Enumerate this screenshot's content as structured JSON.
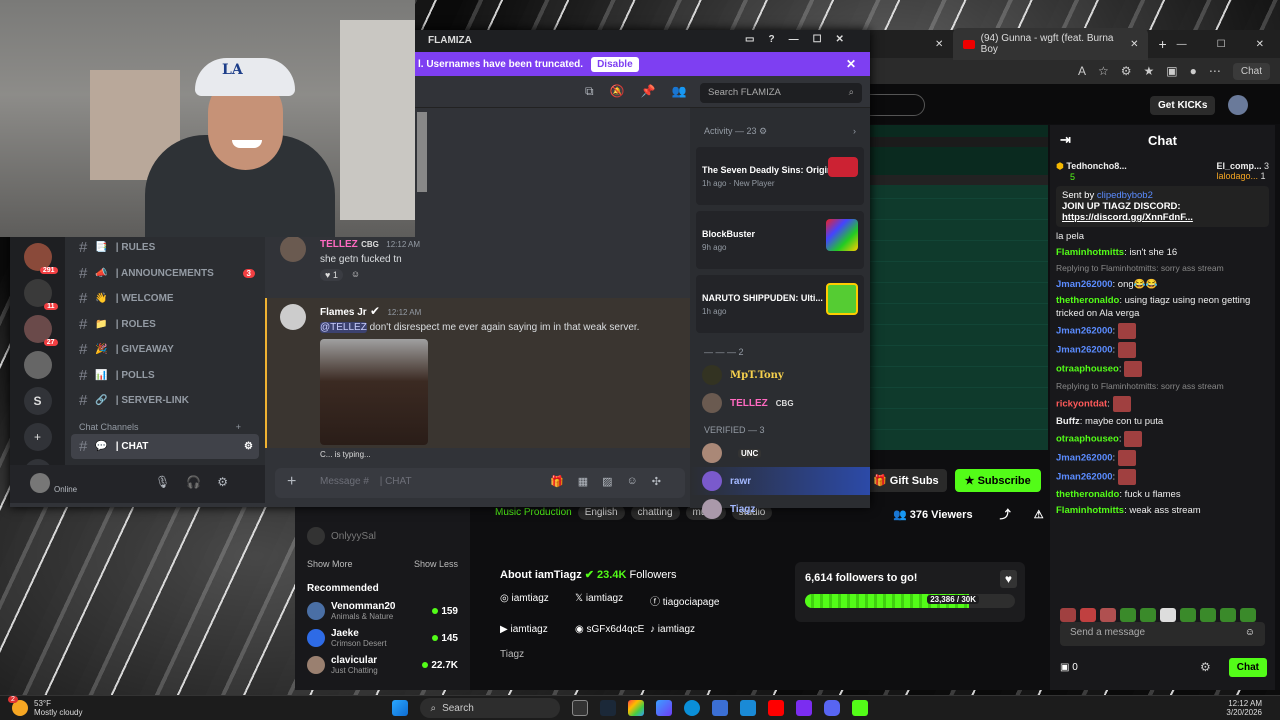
{
  "browser": {
    "tab_label": "(94) Gunna - wgft (feat. Burna Boy",
    "chat_button": "Chat",
    "get_kicks": "Get KICKs"
  },
  "stream": {
    "gift_subs": "Gift Subs",
    "subscribe": "Subscribe",
    "viewers": "376 Viewers",
    "category": "Music Production",
    "tags": [
      "English",
      "chatting",
      "music",
      "studio"
    ]
  },
  "sidebar": {
    "offline_user": "OnlyyySal",
    "show_more": "Show More",
    "show_less": "Show Less",
    "recommended_title": "Recommended",
    "recommended": [
      {
        "name": "Venomman20",
        "sub": "Animals & Nature",
        "count": "159"
      },
      {
        "name": "Jaeke",
        "sub": "Crimson Desert",
        "count": "145"
      },
      {
        "name": "clavicular",
        "sub": "Just Chatting",
        "count": "22.7K"
      }
    ]
  },
  "about": {
    "title": "About iamTiagz",
    "followers": "23.4K",
    "followers_label": "Followers",
    "socials": [
      "iamtiagz",
      "iamtiagz",
      "tiagociapage",
      "iamtiagz",
      "sGFx6d4qcE",
      "iamtiagz"
    ],
    "bio": "Tiagz"
  },
  "follow_goal": {
    "title": "6,614 followers to go!",
    "progress_text": "23,386 / 30K",
    "progress": 0.78
  },
  "chat": {
    "title": "Chat",
    "leaders": [
      {
        "name": "Tedhoncho8...",
        "count": "5"
      },
      {
        "name": "El_comp...",
        "count": "3"
      },
      {
        "name": "lalodago...",
        "count": "1"
      }
    ],
    "pinned_by": "Sent by",
    "pinned_user": "clipedbybob2",
    "pinned_text": "JOIN UP TIAGZ DISCORD:",
    "pinned_link": "https://discord.gg/XnnFdnF...",
    "messages": [
      {
        "user": "",
        "text": "la pela",
        "color": "white"
      },
      {
        "user": "Flaminhotmitts",
        "text": ": isn't she 16",
        "color": "green"
      },
      {
        "reply": "Replying to Flaminhotmitts: sorry ass stream"
      },
      {
        "user": "Jman262000",
        "text": ": ong😂😂",
        "color": "blue"
      },
      {
        "user": "thetheronaldo",
        "text": ": using tiagz using neon getting tricked on Ala verga",
        "color": "green"
      },
      {
        "user": "Jman262000",
        "text": ":",
        "color": "blue",
        "emote": true
      },
      {
        "user": "Jman262000",
        "text": ":",
        "color": "blue",
        "emote": true
      },
      {
        "user": "otraaphouseo",
        "text": ":",
        "color": "green",
        "emote": true
      },
      {
        "reply": "Replying to Flaminhotmitts: sorry ass stream"
      },
      {
        "user": "rickyontdat",
        "text": ":",
        "color": "red",
        "emote": true
      },
      {
        "user": "Buffz",
        "text": ": maybe con tu puta",
        "color": "white"
      },
      {
        "user": "otraaphouseo",
        "text": ":",
        "color": "green",
        "emote": true
      },
      {
        "user": "Jman262000",
        "text": ":",
        "color": "blue",
        "emote": true
      },
      {
        "user": "Jman262000",
        "text": ":",
        "color": "blue",
        "emote": true
      },
      {
        "user": "thetheronaldo",
        "text": ": fuck u flames",
        "color": "green"
      },
      {
        "user": "Flaminhotmitts",
        "text": ": weak ass stream",
        "color": "green"
      }
    ],
    "input_placeholder": "Send a message",
    "points": "0",
    "send": "Chat"
  },
  "discord": {
    "window_title": "FLAMIZA",
    "banner_text": "l. Usernames have been truncated.",
    "banner_button": "Disable",
    "search_placeholder": "Search FLAMIZA",
    "channels": [
      {
        "icon": "📑",
        "name": "| RULES"
      },
      {
        "icon": "📣",
        "name": "| ANNOUNCEMENTS",
        "badge": "3"
      },
      {
        "icon": "👋",
        "name": "| WELCOME"
      },
      {
        "icon": "📁",
        "name": "| ROLES"
      },
      {
        "icon": "🎉",
        "name": "| GIVEAWAY"
      },
      {
        "icon": "📊",
        "name": "| POLLS"
      },
      {
        "icon": "🔗",
        "name": "| SERVER-LINK"
      }
    ],
    "chat_channels_label": "Chat Channels",
    "active_channel": "| CHAT",
    "server_badges": [
      "291",
      "11",
      "27"
    ],
    "server_letter": "S",
    "user_status": "Online",
    "messages": [
      {
        "author": "TELLEZ",
        "tag": "CBG",
        "time": "12:12 AM",
        "text": "she getn fucked tn",
        "reaction_count": "1"
      },
      {
        "author": "Flames Jr",
        "time": "12:12 AM",
        "mention": "@TELLEZ",
        "text": " don't disrespect me ever again saying im in that weak server."
      }
    ],
    "typing": "C... is typing...",
    "input_placeholder": "Message #",
    "input_channel": "| CHAT",
    "activity_label": "Activity — 23",
    "activities": [
      {
        "title": "The Seven Deadly Sins: Origin",
        "sub": "1h ago",
        "extra": "New Player"
      },
      {
        "title": "BlockBuster",
        "sub": "9h ago"
      },
      {
        "title": "NARUTO SHIPPUDEN: Ulti...",
        "sub": "1h ago"
      }
    ],
    "group2_label": "— — — 2",
    "group2": [
      {
        "name": "MpT.Tony"
      },
      {
        "name": "TELLEZ",
        "tag": "CBG"
      }
    ],
    "verified_label": "VERIFIED — 3",
    "verified": [
      {
        "name": "",
        "tag": "UNC"
      },
      {
        "name": "rawr"
      },
      {
        "name": "Tiagz"
      }
    ]
  },
  "taskbar": {
    "weather_temp": "53°F",
    "weather_desc": "Mostly cloudy",
    "search": "Search",
    "time": "12:12 AM",
    "date": "3/20/2026",
    "weather_badge": "2"
  }
}
